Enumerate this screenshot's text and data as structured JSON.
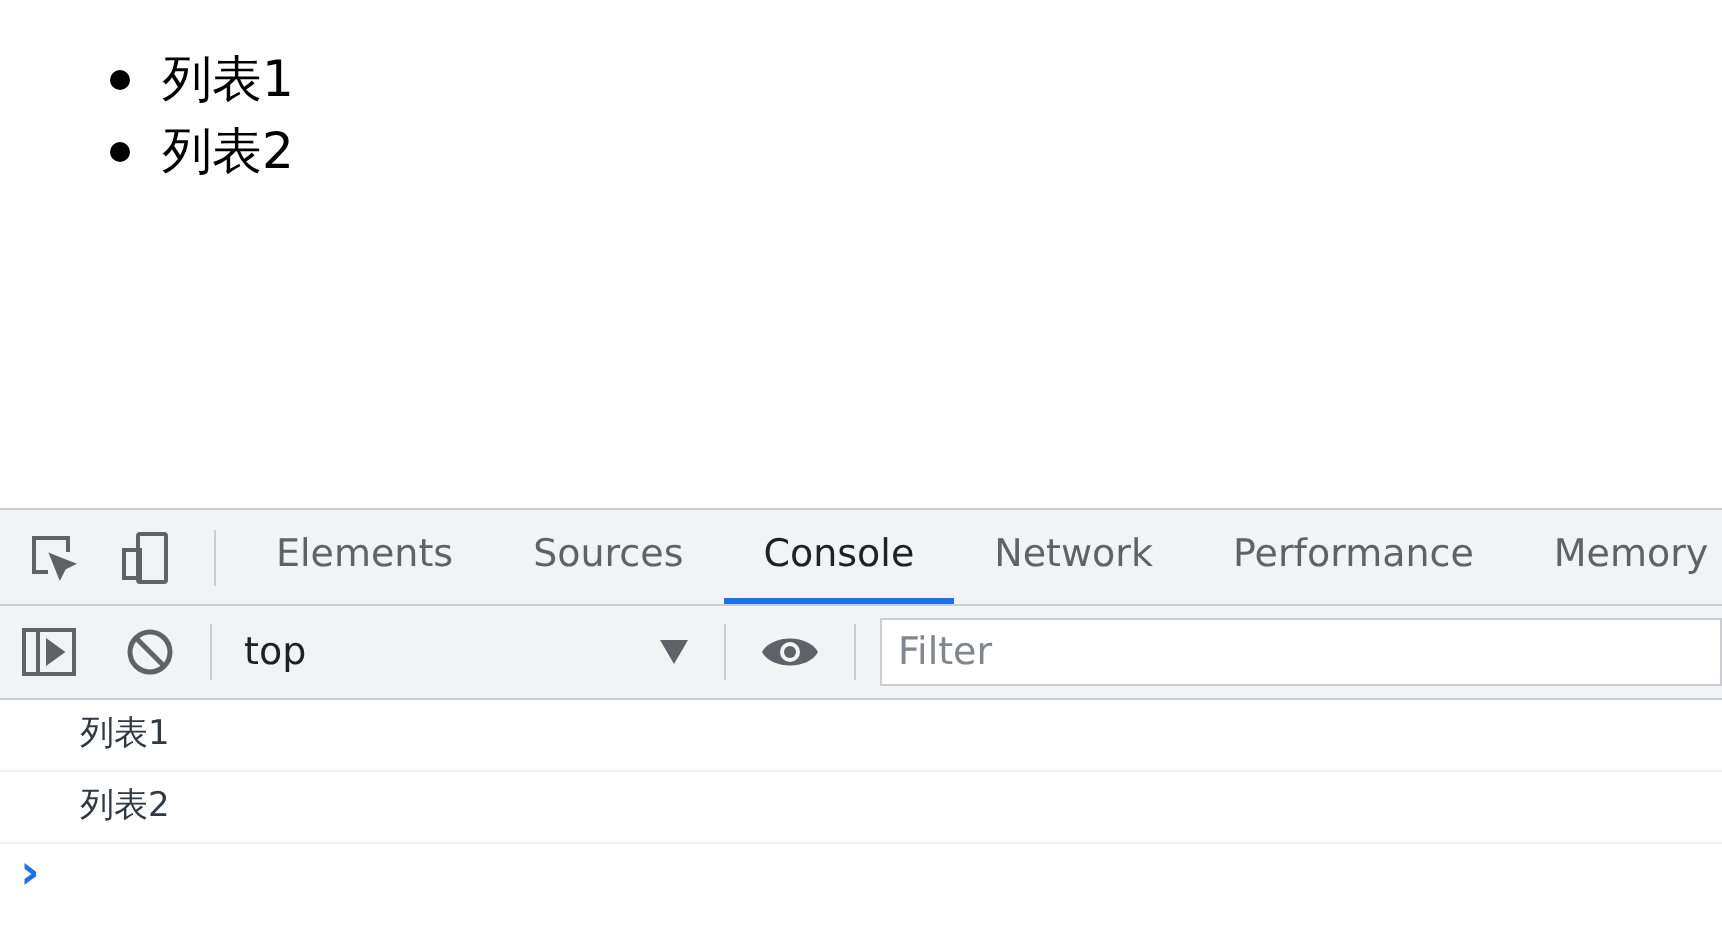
{
  "page": {
    "list_items": [
      "列表1",
      "列表2"
    ]
  },
  "devtools": {
    "tabs": [
      {
        "label": "Elements",
        "selected": false
      },
      {
        "label": "Sources",
        "selected": false
      },
      {
        "label": "Console",
        "selected": true
      },
      {
        "label": "Network",
        "selected": false
      },
      {
        "label": "Performance",
        "selected": false
      },
      {
        "label": "Memory",
        "selected": false
      }
    ],
    "context": "top",
    "filter": {
      "placeholder": "Filter"
    },
    "messages": [
      "列表1",
      "列表2"
    ],
    "prompt": "›"
  }
}
